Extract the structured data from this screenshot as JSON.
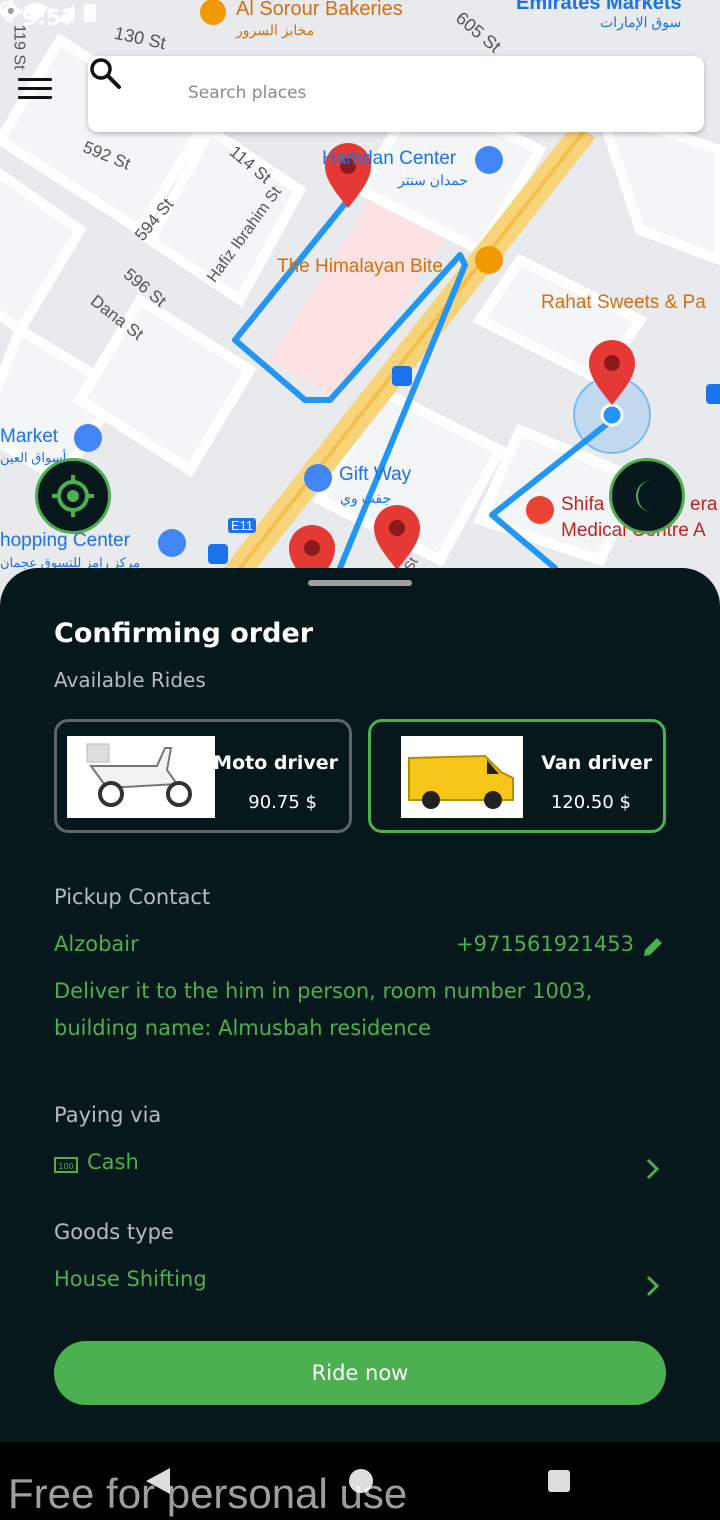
{
  "status_bar": {
    "time": "9:57"
  },
  "search": {
    "placeholder": "Search places"
  },
  "map": {
    "labels": {
      "bakery": "Al Sorour Bakeries",
      "bakery_ar": "مخابز السرور",
      "markets": "Emirates Markets",
      "markets_ar": "سوق الإمارات",
      "hamdan": "Hamdan Center",
      "hamdan_ar": "حمدان سنتر",
      "himalayan": "The Himalayan Bite",
      "rahat": "Rahat Sweets & Pa",
      "market_left": "Market",
      "market_left_ar": "أسواق العين",
      "gift": "Gift Way",
      "gift_ar": "جفت وي",
      "shifa": "Shifa",
      "shifa_2": "era",
      "medical": "Medical Centre A",
      "shopping": "hopping Center",
      "shopping_ar": "مركز رامز للتسوق عجمان",
      "road": "E11",
      "st_119": "119 St",
      "st_130": "130 St",
      "st_605": "605 St",
      "st_592": "592 St",
      "st_114": "114 St",
      "st_594": "594 St",
      "st_596": "596 St",
      "st_dana": "Dana St",
      "st_hafiz": "Hafiz Ibrahim St",
      "st_small": "St"
    }
  },
  "sheet": {
    "title": "Confirming order",
    "subtitle": "Available Rides",
    "rides": [
      {
        "name": "Moto driver",
        "price": "90.75 $",
        "selected": false
      },
      {
        "name": "Van driver",
        "price": "120.50 $",
        "selected": true
      }
    ],
    "pickup_label": "Pickup Contact",
    "contact_name": "Alzobair",
    "contact_phone": "+971561921453",
    "note_line1": "Deliver it to the him in person, room number 1003,",
    "note_line2": "building name: Almusbah residence",
    "paying_label": "Paying via",
    "paying_value": "Cash",
    "goods_label": "Goods type",
    "goods_value": "House Shifting",
    "ride_button": "Ride now"
  },
  "watermark": "Free for personal use",
  "colors": {
    "accent": "#4caf50",
    "sheet_bg": "#06181c",
    "route": "#2196f3",
    "pin": "#e53935"
  }
}
